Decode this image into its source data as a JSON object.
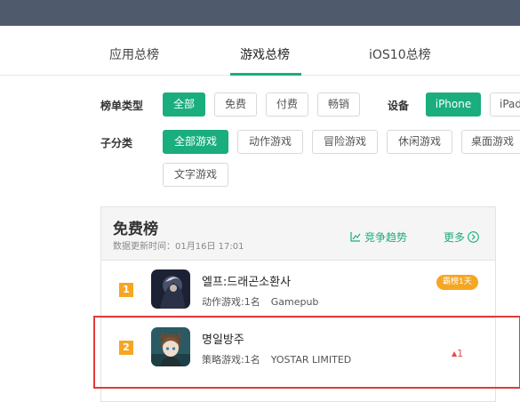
{
  "tabs": [
    {
      "label": "应用总榜"
    },
    {
      "label": "游戏总榜"
    },
    {
      "label": "iOS10总榜"
    }
  ],
  "filters": {
    "rank_type_label": "榜单类型",
    "rank_types": [
      "全部",
      "免费",
      "付费",
      "畅销"
    ],
    "device_label": "设备",
    "devices": [
      "iPhone",
      "iPad"
    ],
    "subcategory_label": "子分类",
    "subcategories": [
      "全部游戏",
      "动作游戏",
      "冒险游戏",
      "休闲游戏",
      "桌面游戏",
      "文字游戏"
    ]
  },
  "panel": {
    "title": "免费榜",
    "update": "数据更新时间：01月16日 17:01",
    "trend_label": "竞争趋势",
    "more_label": "更多"
  },
  "apps": [
    {
      "rank": "1",
      "name": "엘프:드래곤소환사",
      "category": "动作游戏:1名",
      "publisher": "Gamepub",
      "badge": "霸榜1天"
    },
    {
      "rank": "2",
      "name": "명일방주",
      "category": "策略游戏:1名",
      "publisher": "YOSTAR LIMITED",
      "change": "1"
    }
  ],
  "colors": {
    "accent": "#1aad7e",
    "rank_badge": "#f5a623",
    "up": "#e24b4b",
    "highlight": "#e03b3b"
  }
}
